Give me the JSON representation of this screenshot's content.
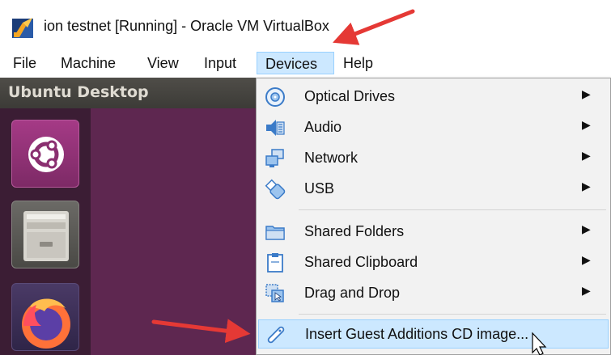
{
  "window": {
    "title": "ion testnet [Running] - Oracle VM VirtualBox",
    "icon": "virtualbox-icon"
  },
  "menubar": {
    "items": [
      {
        "label": "File",
        "active": false
      },
      {
        "label": "Machine",
        "active": false
      },
      {
        "label": "View",
        "active": false
      },
      {
        "label": "Input",
        "active": false
      },
      {
        "label": "Devices",
        "active": true
      },
      {
        "label": "Help",
        "active": false
      }
    ]
  },
  "vm": {
    "topbar_title": "Ubuntu Desktop",
    "launcher": [
      {
        "name": "ubuntu-software-icon"
      },
      {
        "name": "files-icon"
      },
      {
        "name": "firefox-icon"
      }
    ]
  },
  "devices_menu": {
    "items": [
      {
        "label": "Optical Drives",
        "icon": "optical-drive-icon",
        "submenu": true
      },
      {
        "label": "Audio",
        "icon": "audio-icon",
        "submenu": true
      },
      {
        "label": "Network",
        "icon": "network-icon",
        "submenu": true
      },
      {
        "label": "USB",
        "icon": "usb-icon",
        "submenu": true
      },
      {
        "label": "Shared Folders",
        "icon": "shared-folders-icon",
        "submenu": true
      },
      {
        "label": "Shared Clipboard",
        "icon": "shared-clipboard-icon",
        "submenu": true
      },
      {
        "label": "Drag and Drop",
        "icon": "drag-and-drop-icon",
        "submenu": true
      },
      {
        "label": "Insert Guest Additions CD image...",
        "icon": "guest-additions-icon",
        "submenu": false,
        "highlighted": true
      }
    ],
    "submenu_arrow": "▶"
  },
  "colors": {
    "menu_highlight": "#cce8ff",
    "menu_highlight_border": "#99d1ff",
    "annotation_arrow": "#e53935",
    "ubuntu_purple": "#5e2750"
  }
}
